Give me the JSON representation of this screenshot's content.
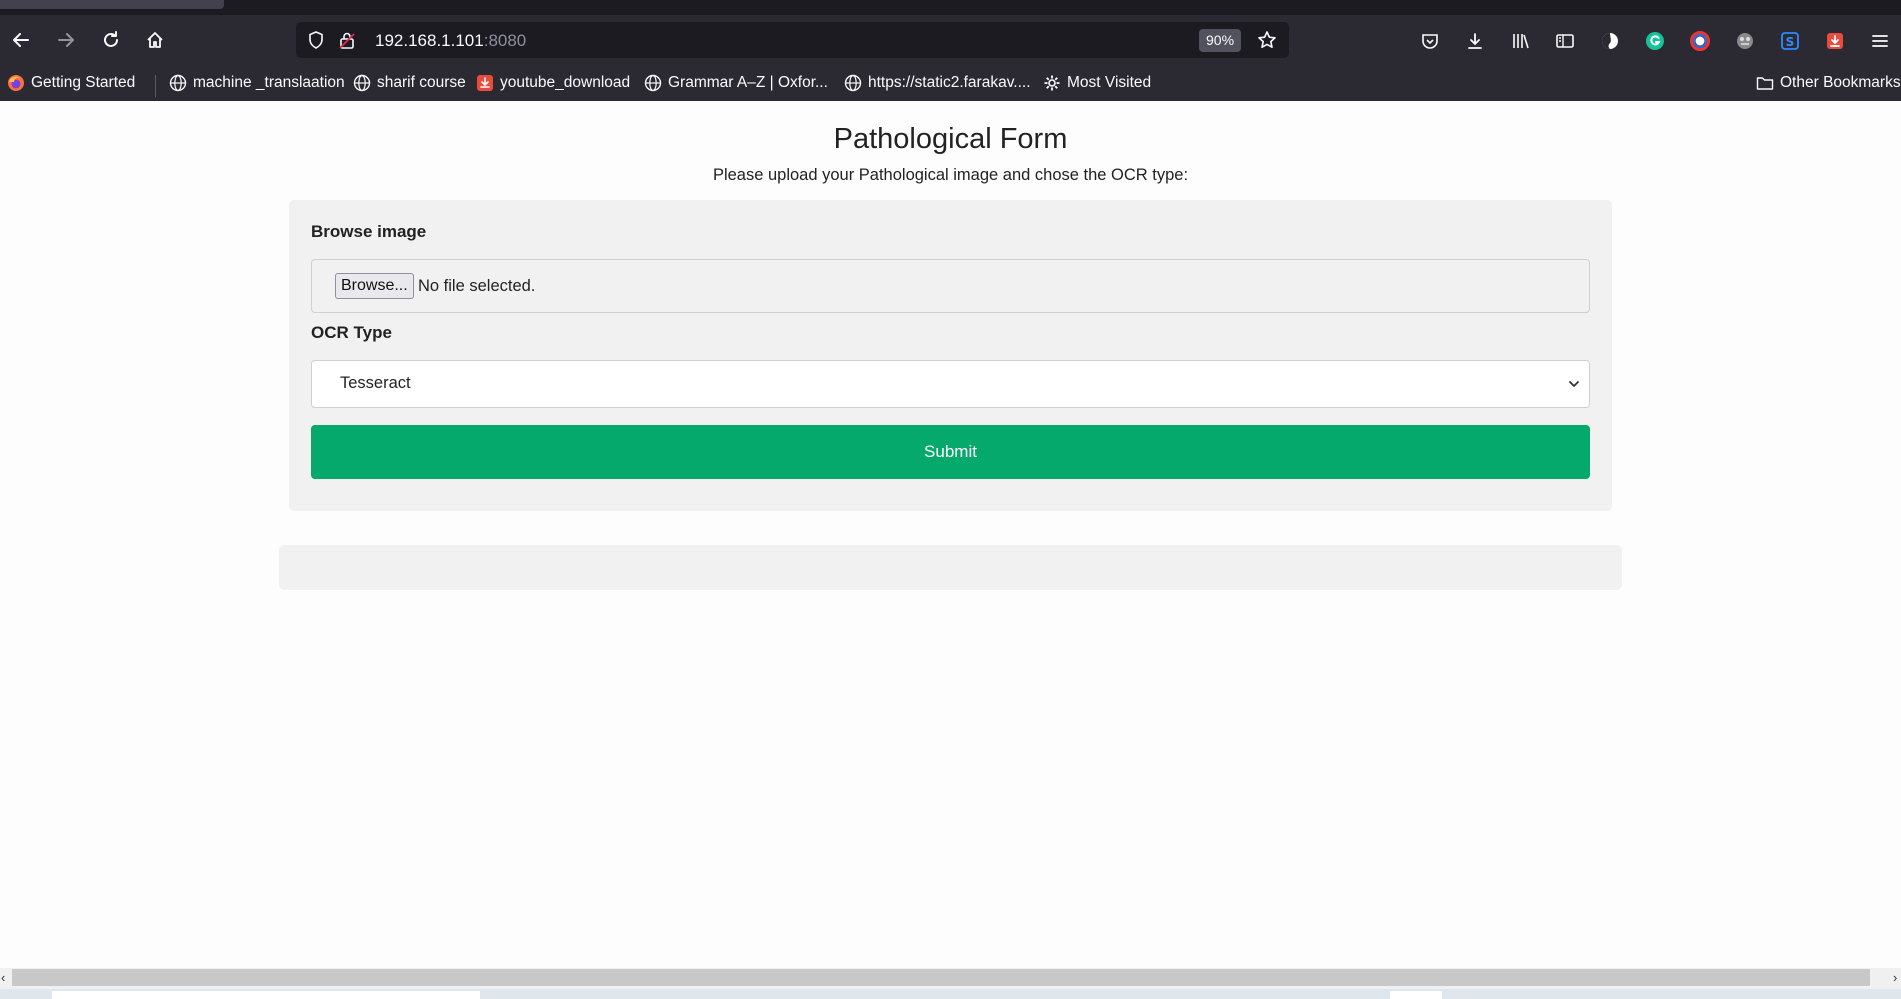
{
  "browser": {
    "url_host": "192.168.1.101",
    "url_port": ":8080",
    "zoom": "90%",
    "icons": {
      "back": "back-arrow-icon",
      "forward": "forward-arrow-icon",
      "reload": "reload-icon",
      "home": "home-icon",
      "tracking": "shield-icon",
      "connection": "lock-icon",
      "bookmark_star": "star-icon",
      "toolbar": [
        "pocket-icon",
        "download-icon",
        "library-icon",
        "sidebar-icon",
        "extension-icon",
        "grammarly-icon",
        "extension-icon",
        "extension-icon",
        "extension-icon",
        "download-helper-icon",
        "menu-icon"
      ]
    },
    "bookmarks": [
      {
        "label": "Getting Started",
        "icon": "firefox-icon"
      },
      {
        "label": "machine _translaation",
        "icon": "globe-icon"
      },
      {
        "label": "sharif course",
        "icon": "globe-icon"
      },
      {
        "label": "youtube_download",
        "icon": "download-red-icon"
      },
      {
        "label": "Grammar A–Z | Oxfor...",
        "icon": "globe-icon"
      },
      {
        "label": "https://static2.farakav....",
        "icon": "globe-icon"
      },
      {
        "label": "Most Visited",
        "icon": "gear-icon"
      }
    ],
    "other_bookmarks": "Other Bookmarks",
    "colors": {
      "chrome": "#2b2a33",
      "tabstrip": "#1c1b22",
      "urlbar": "#1c1b22"
    }
  },
  "page": {
    "title": "Pathological Form",
    "subtitle": "Please upload your Pathological image and chose the OCR type:",
    "browse_label": "Browse image",
    "browse_button": "Browse...",
    "file_status": "No file selected.",
    "ocr_label": "OCR Type",
    "ocr_selected": "Tesseract",
    "submit_label": "Submit",
    "colors": {
      "submit": "#05a96b",
      "card": "#f1f1f1"
    }
  }
}
